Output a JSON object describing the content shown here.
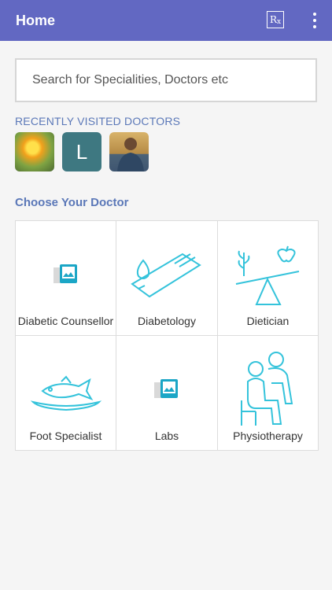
{
  "appbar": {
    "title": "Home",
    "rx_icon": "rx-icon",
    "menu_icon": "more-vert-icon"
  },
  "search": {
    "placeholder": "Search for Specialities, Doctors etc"
  },
  "recent": {
    "label": "RECENTLY VISITED DOCTORS",
    "avatars": [
      {
        "type": "photo"
      },
      {
        "type": "initial",
        "letter": "L"
      },
      {
        "type": "photo"
      }
    ]
  },
  "choose": {
    "label": "Choose Your Doctor",
    "tiles": [
      {
        "label": "Diabetic Counsellor",
        "icon": "image-placeholder-icon"
      },
      {
        "label": "Diabetology",
        "icon": "test-strip-icon"
      },
      {
        "label": "Dietician",
        "icon": "balance-scale-icon"
      },
      {
        "label": "Foot Specialist",
        "icon": "fish-plate-icon"
      },
      {
        "label": "Labs",
        "icon": "image-placeholder-icon"
      },
      {
        "label": "Physiotherapy",
        "icon": "physiotherapy-icon"
      }
    ]
  },
  "colors": {
    "appbar": "#6268c2",
    "accent": "#5b78b8",
    "icon_cyan": "#34c3db"
  }
}
